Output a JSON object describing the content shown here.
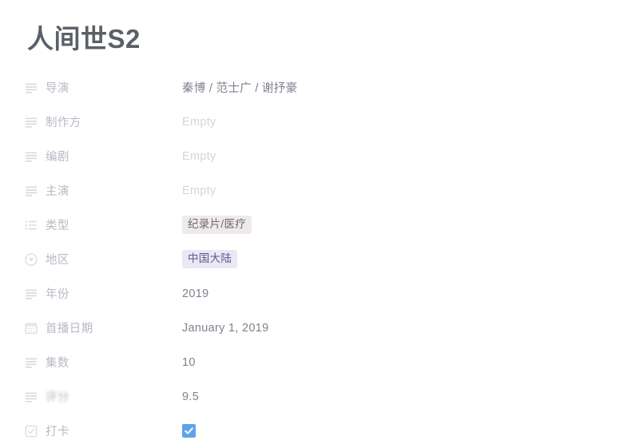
{
  "page": {
    "title": "人间世S2",
    "background_color": "#ffffff",
    "title_color": "#5b6068"
  },
  "colors": {
    "label": "#b6bac2",
    "value": "#7d828c",
    "empty": "#d3d6dc",
    "pill_genre_bg": "#eeeaea",
    "pill_genre_text": "#6f6a6a",
    "pill_region_bg": "#eae8f6",
    "pill_region_text": "#5f5a8a",
    "checkbox_checked": "#5ca4e8"
  },
  "properties": [
    {
      "label": "导演",
      "icon": "text-lines-icon",
      "type": "text",
      "value": "秦博 / 范士广 / 谢抒豪",
      "empty": false
    },
    {
      "label": "制作方",
      "icon": "text-lines-icon",
      "type": "text",
      "value": "Empty",
      "empty": true
    },
    {
      "label": "编剧",
      "icon": "text-lines-icon",
      "type": "text",
      "value": "Empty",
      "empty": true
    },
    {
      "label": "主演",
      "icon": "text-lines-icon",
      "type": "text",
      "value": "Empty",
      "empty": true
    },
    {
      "label": "类型",
      "icon": "bulleted-list-icon",
      "type": "multi-select",
      "value": "纪录片/医疗",
      "empty": false
    },
    {
      "label": "地区",
      "icon": "select-circle-chevron-icon",
      "type": "select",
      "value": "中国大陆",
      "empty": false
    },
    {
      "label": "年份",
      "icon": "text-lines-icon",
      "type": "text",
      "value": "2019",
      "empty": false
    },
    {
      "label": "首播日期",
      "icon": "calendar-icon",
      "type": "date",
      "value": "January 1, 2019",
      "empty": false
    },
    {
      "label": "集数",
      "icon": "text-lines-icon",
      "type": "text",
      "value": "10",
      "empty": false
    },
    {
      "label": "评分",
      "icon": "text-lines-icon",
      "type": "text",
      "value": "9.5",
      "empty": false,
      "redacted": true
    },
    {
      "label": "打卡",
      "icon": "checkbox-check-icon",
      "type": "checkbox",
      "value": "checked",
      "empty": false
    }
  ]
}
